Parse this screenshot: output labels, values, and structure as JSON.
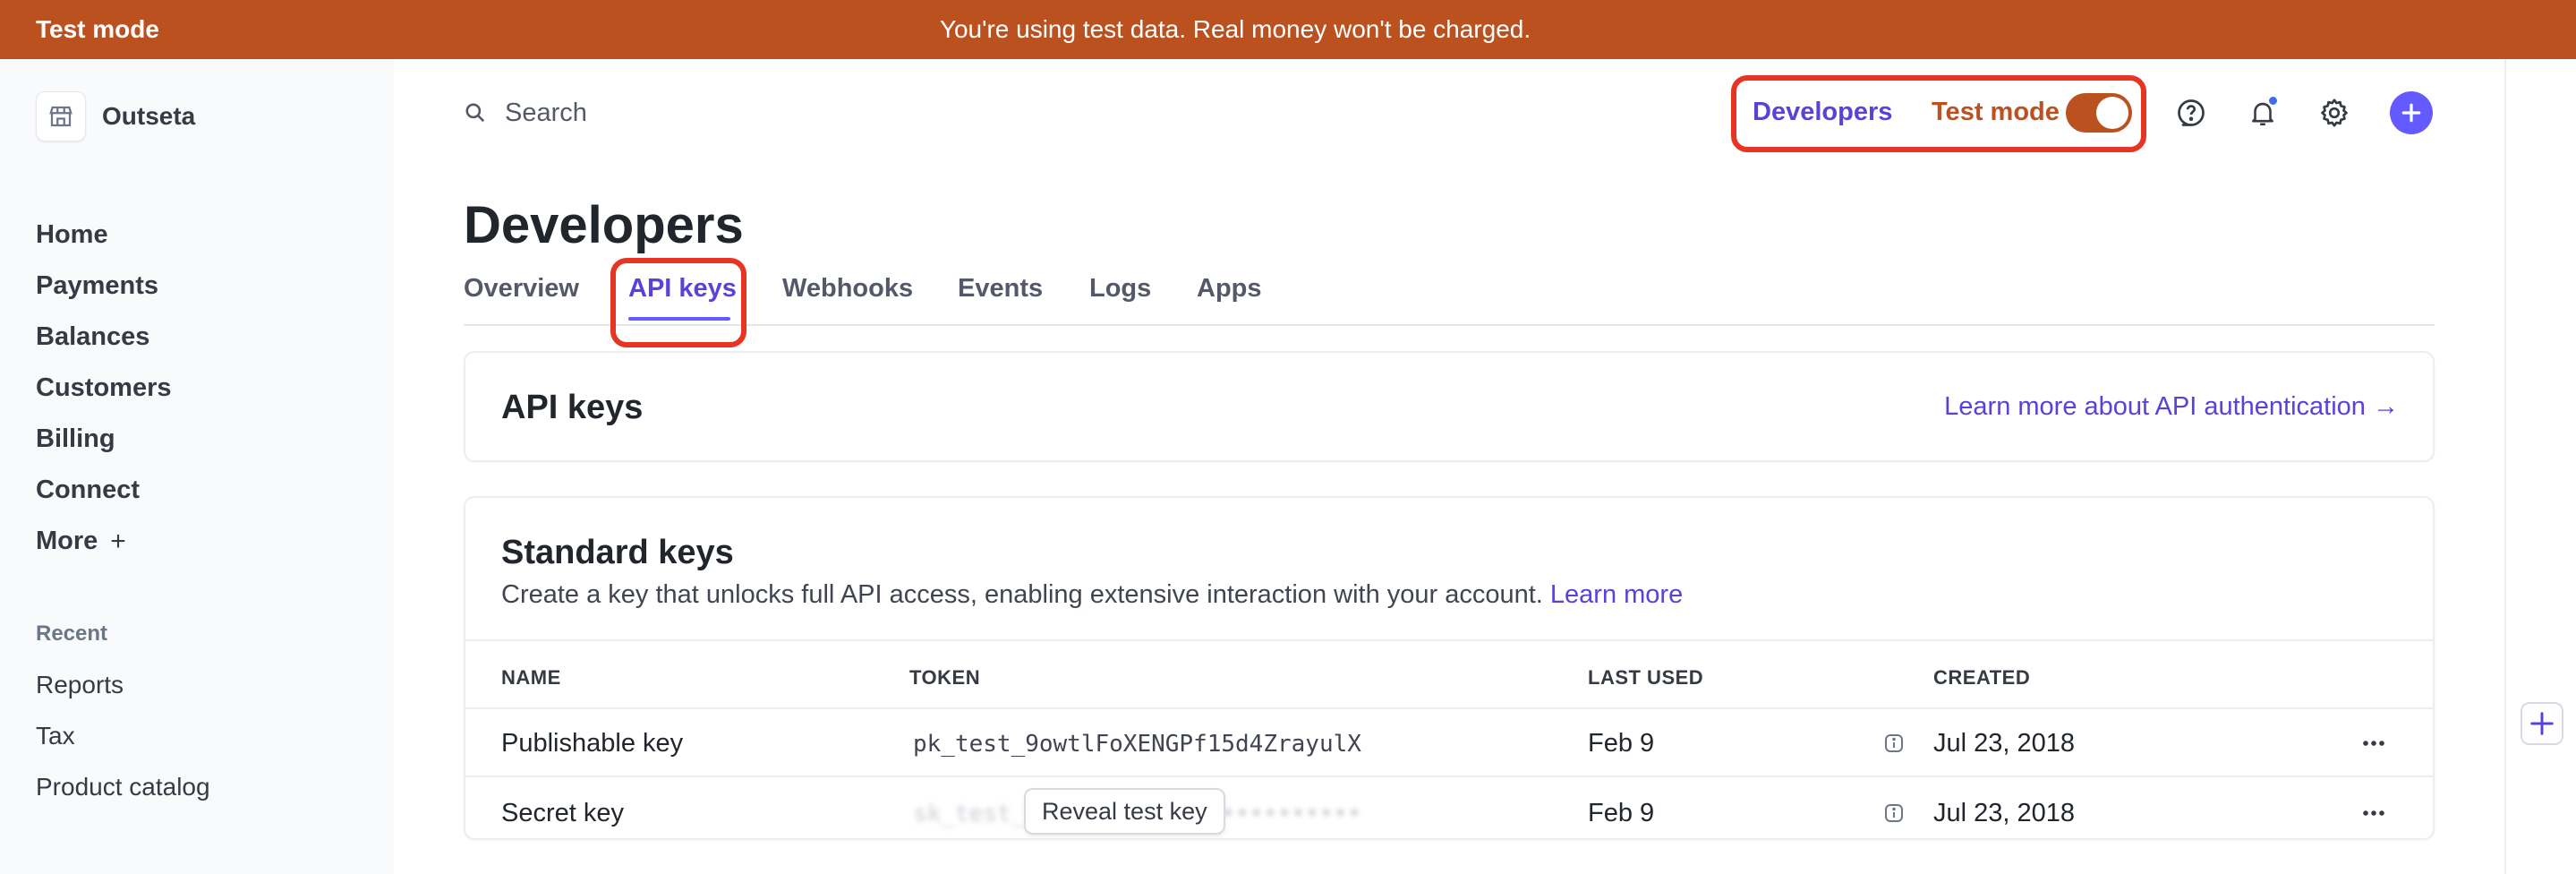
{
  "banner": {
    "label": "Test mode",
    "message": "You're using test data. Real money won't be charged."
  },
  "account": {
    "name": "Outseta",
    "logo_icon": "store-icon"
  },
  "sidebar": {
    "items": [
      {
        "label": "Home"
      },
      {
        "label": "Payments"
      },
      {
        "label": "Balances"
      },
      {
        "label": "Customers"
      },
      {
        "label": "Billing"
      },
      {
        "label": "Connect"
      },
      {
        "label": "More",
        "suffix": "+"
      }
    ],
    "recent_label": "Recent",
    "recent_items": [
      {
        "label": "Reports"
      },
      {
        "label": "Tax"
      },
      {
        "label": "Product catalog"
      }
    ]
  },
  "topbar": {
    "search_placeholder": "Search",
    "developers_label": "Developers",
    "test_mode_label": "Test mode",
    "test_mode_on": true,
    "icons": [
      "help-icon",
      "bell-icon",
      "gear-icon",
      "plus-icon"
    ]
  },
  "page": {
    "title": "Developers",
    "tabs": [
      {
        "label": "Overview",
        "active": false
      },
      {
        "label": "API keys",
        "active": true
      },
      {
        "label": "Webhooks",
        "active": false
      },
      {
        "label": "Events",
        "active": false
      },
      {
        "label": "Logs",
        "active": false
      },
      {
        "label": "Apps",
        "active": false
      }
    ]
  },
  "api_card": {
    "title": "API keys",
    "link": "Learn more about API authentication →"
  },
  "standard_keys": {
    "title": "Standard keys",
    "description": "Create a key that unlocks full API access, enabling extensive interaction with your account.",
    "learn_more": "Learn more",
    "columns": [
      "NAME",
      "TOKEN",
      "LAST USED",
      "CREATED"
    ],
    "rows": [
      {
        "name": "Publishable key",
        "token": "pk_test_9owtlFoXENGPf15d4ZrayulX",
        "last_used": "Feb 9",
        "created": "Jul 23, 2018"
      },
      {
        "name": "Secret key",
        "token": "sk_test_••••••••••••••••••••••••",
        "last_used": "Feb 9",
        "created": "Jul 23, 2018",
        "reveal_label": "Reveal test key"
      }
    ]
  },
  "colors": {
    "banner": "#bc5120",
    "accent": "#635bff",
    "link": "#5a41d9",
    "highlight": "#e63522"
  }
}
